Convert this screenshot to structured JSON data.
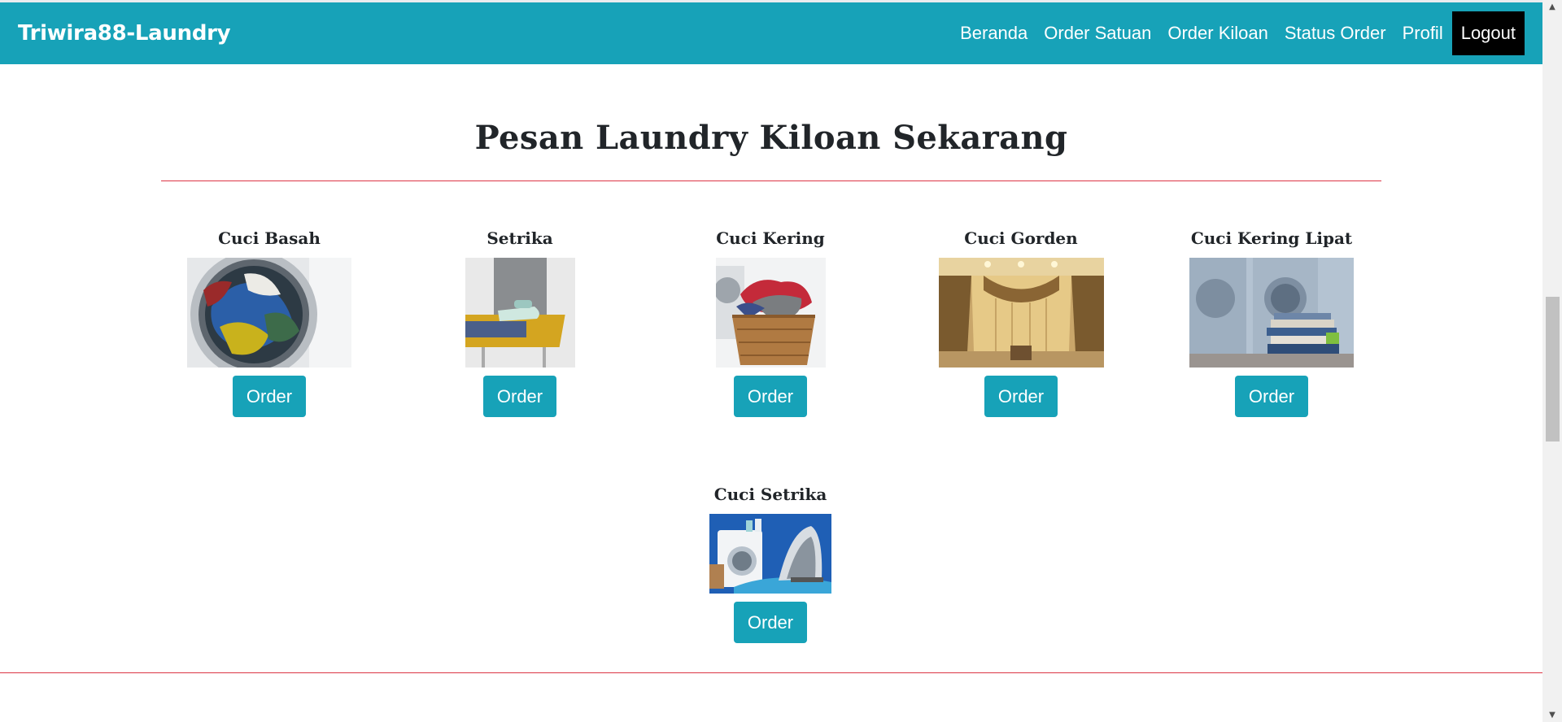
{
  "navbar": {
    "brand": "Triwira88-Laundry",
    "links": [
      "Beranda",
      "Order Satuan",
      "Order Kiloan",
      "Status Order",
      "Profil"
    ],
    "logout": "Logout"
  },
  "page": {
    "title": "Pesan Laundry Kiloan Sekarang"
  },
  "services": [
    {
      "name": "Cuci Basah",
      "button": "Order"
    },
    {
      "name": "Setrika",
      "button": "Order"
    },
    {
      "name": "Cuci Kering",
      "button": "Order"
    },
    {
      "name": "Cuci Gorden",
      "button": "Order"
    },
    {
      "name": "Cuci Kering Lipat",
      "button": "Order"
    },
    {
      "name": "Cuci Setrika",
      "button": "Order"
    }
  ],
  "colors": {
    "primary": "#17a2b8",
    "divider": "#dc3545",
    "logout_bg": "#000000"
  }
}
